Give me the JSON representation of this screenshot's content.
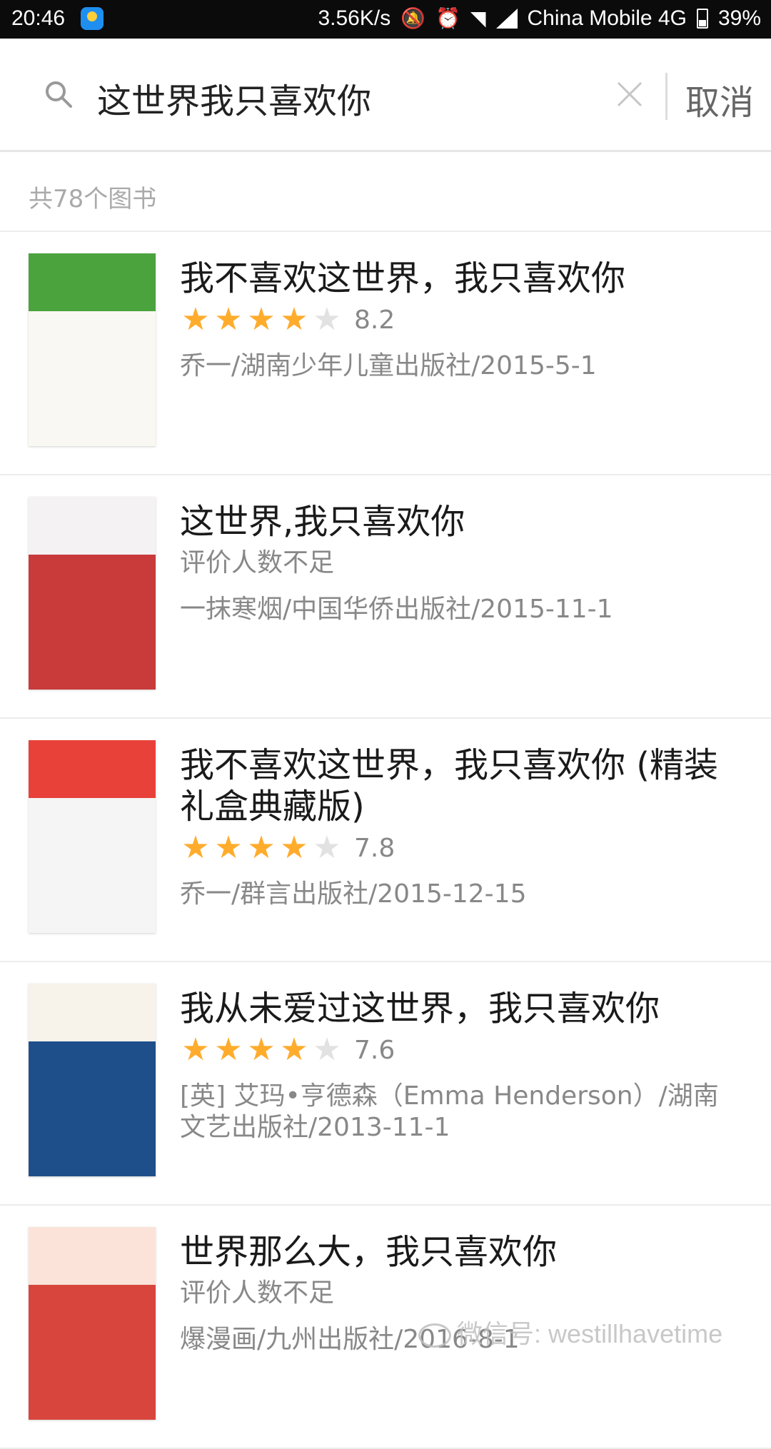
{
  "status_bar": {
    "time": "20:46",
    "net_speed": "3.56K/s",
    "carrier": "China Mobile 4G",
    "battery": "39%"
  },
  "search": {
    "query": "这世界我只喜欢你",
    "cancel_label": "取消"
  },
  "results": {
    "count_text": "共78个图书"
  },
  "books": [
    {
      "title": "我不喜欢这世界，我只喜欢你",
      "stars": 4,
      "score": "8.2",
      "rating_text": "",
      "publisher": "乔一/湖南少年儿童出版社/2015-5-1",
      "cover_colors": [
        "#4aa33d",
        "#faf8f2"
      ]
    },
    {
      "title": "这世界,我只喜欢你",
      "stars": 0,
      "score": "",
      "rating_text": "评价人数不足",
      "publisher": "一抹寒烟/中国华侨出版社/2015-11-1",
      "cover_colors": [
        "#f4f2f2",
        "#c93a3a"
      ]
    },
    {
      "title": "我不喜欢这世界，我只喜欢你 (精装礼盒典藏版)",
      "stars": 4,
      "score": "7.8",
      "rating_text": "",
      "publisher": "乔一/群言出版社/2015-12-15",
      "cover_colors": [
        "#e8413a",
        "#f5f5f5"
      ]
    },
    {
      "title": "我从未爱过这世界，我只喜欢你",
      "stars": 4,
      "score": "7.6",
      "rating_text": "",
      "publisher": "[英] 艾玛•亨德森（Emma Henderson）/湖南文艺出版社/2013-11-1",
      "cover_colors": [
        "#f7f3ea",
        "#1f4f8a"
      ]
    },
    {
      "title": "世界那么大，我只喜欢你",
      "stars": 0,
      "score": "",
      "rating_text": "评价人数不足",
      "publisher": "爆漫画/九州出版社/2016-8-1",
      "cover_colors": [
        "#fbe3da",
        "#d8453c"
      ]
    }
  ],
  "watermark": {
    "text": "微信号: westillhavetime"
  },
  "colors": {
    "star_on": "#ffac2d",
    "star_off": "#e2e2e2",
    "muted_text": "#888888"
  }
}
